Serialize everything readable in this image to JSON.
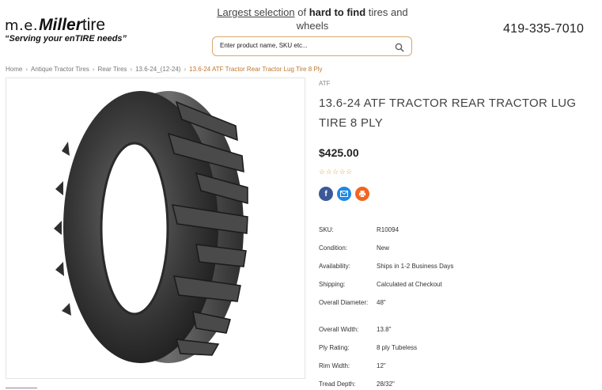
{
  "header": {
    "logo_me": "m.e.",
    "logo_miller": "Miller",
    "logo_tire": "tire",
    "logo_tagline": "“Serving your enTIRE needs”",
    "tagline_part1": "Largest selection",
    "tagline_part2": " of ",
    "tagline_part3": "hard to find",
    "tagline_part4": " tires and wheels",
    "phone": "419-335-7010"
  },
  "search": {
    "placeholder": "Enter product name, SKU etc...",
    "icon": "search-icon"
  },
  "breadcrumb": [
    "Home",
    "Antique Tractor Tires",
    "Rear Tires",
    "13.6-24_(12-24)",
    "13.6-24 ATF Tractor Rear Tractor Lug Tire 8 Ply"
  ],
  "product": {
    "brand": "ATF",
    "title": "13.6-24 ATF TRACTOR REAR TRACTOR LUG TIRE 8 PLY",
    "price": "$425.00",
    "rating_stars": "☆☆☆☆☆",
    "rating": 0,
    "share_icons": [
      "facebook-icon",
      "email-icon",
      "print-icon"
    ],
    "specs": [
      {
        "label": "SKU:",
        "value": "R10094"
      },
      {
        "label": "Condition:",
        "value": "New"
      },
      {
        "label": "Availability:",
        "value": "Ships in 1-2 Business Days"
      },
      {
        "label": "Shipping:",
        "value": "Calculated at Checkout"
      },
      {
        "label": "Overall Diameter:",
        "value": "48\""
      },
      {
        "label": "Overall Width:",
        "value": "13.8\""
      },
      {
        "label": "Ply Rating:",
        "value": "8 ply Tubeless"
      },
      {
        "label": "Rim Width:",
        "value": "12\""
      },
      {
        "label": "Tread Depth:",
        "value": "28/32\""
      }
    ]
  },
  "colors": {
    "accent": "#c0762e",
    "search_border": "#d8a86a",
    "star": "#e0a33c",
    "facebook": "#3b5998",
    "email": "#1e88e5",
    "print": "#f26522"
  }
}
